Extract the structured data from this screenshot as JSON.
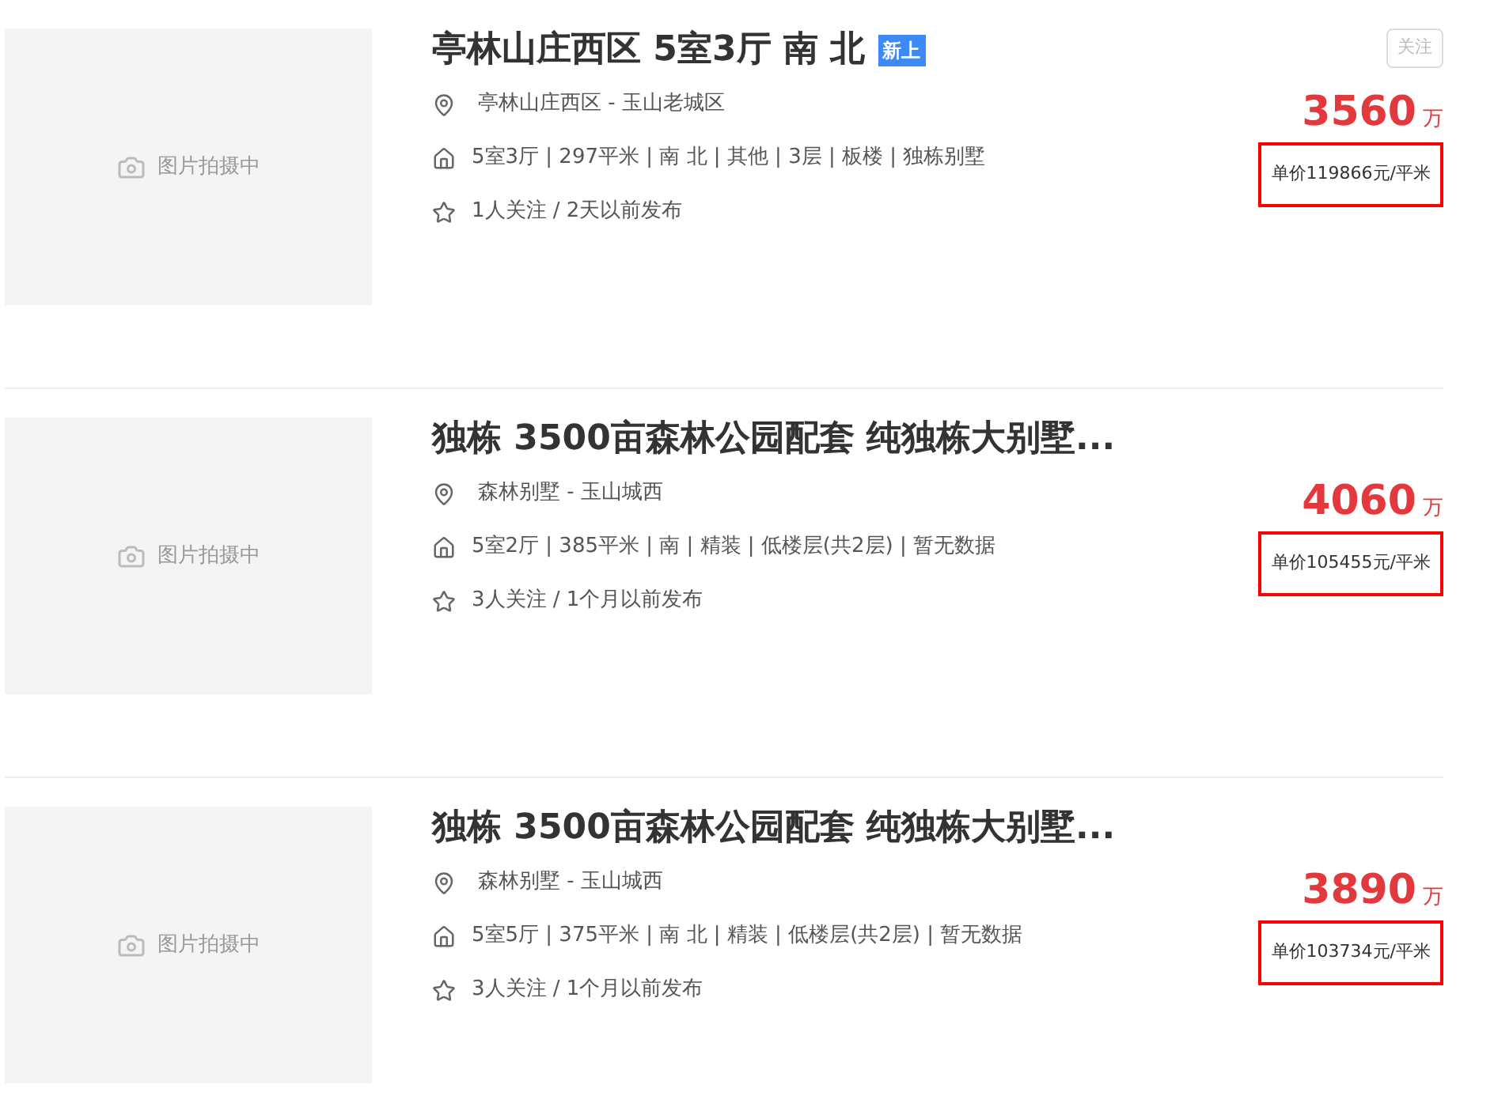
{
  "listings": [
    {
      "photo_placeholder": "图片拍摄中",
      "title": "亭林山庄西区 5室3厅 南 北",
      "badge": "新上",
      "follow_button": "关注",
      "location": "亭林山庄西区 - 玉山老城区",
      "details": "5室3厅 | 297平米 | 南 北 | 其他 | 3层 | 板楼 | 独栋别墅",
      "followers": "1人关注 / 2天以前发布",
      "price": "3560",
      "price_unit": "万",
      "unit_price": "单价119866元/平米",
      "unit_price_highlighted": true
    },
    {
      "photo_placeholder": "图片拍摄中",
      "title": "独栋 3500亩森林公园配套 纯独栋大别墅...",
      "location": "森林别墅 - 玉山城西",
      "details": "5室2厅 | 385平米 | 南 | 精装 | 低楼层(共2层) | 暂无数据",
      "followers": "3人关注 / 1个月以前发布",
      "price": "4060",
      "price_unit": "万",
      "unit_price": "单价105455元/平米",
      "unit_price_highlighted": true
    },
    {
      "photo_placeholder": "图片拍摄中",
      "title": "独栋 3500亩森林公园配套 纯独栋大别墅...",
      "location": "森林别墅 - 玉山城西",
      "details": "5室5厅 | 375平米 | 南 北 | 精装 | 低楼层(共2层) | 暂无数据",
      "followers": "3人关注 / 1个月以前发布",
      "price": "3890",
      "price_unit": "万",
      "unit_price": "单价103734元/平米",
      "unit_price_highlighted": true
    }
  ]
}
